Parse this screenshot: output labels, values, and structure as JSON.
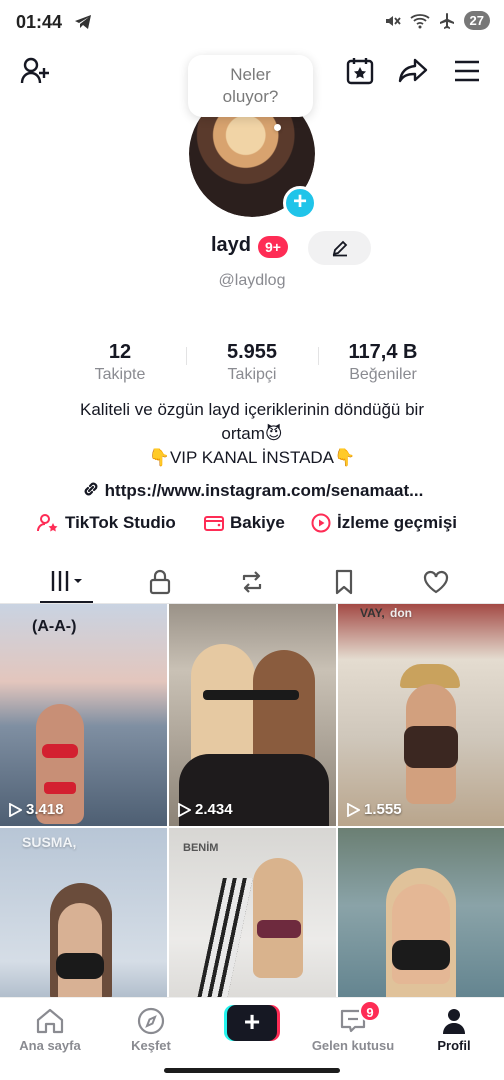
{
  "status": {
    "time": "01:44",
    "battery": "27"
  },
  "header": {
    "bubble_line1": "Neler",
    "bubble_line2": "oluyor?"
  },
  "profile": {
    "username": "layd",
    "badge": "9+",
    "handle": "@laydlog",
    "stats": [
      {
        "value": "12",
        "label": "Takipte"
      },
      {
        "value": "5.955",
        "label": "Takipçi"
      },
      {
        "value": "117,4 B",
        "label": "Beğeniler"
      }
    ],
    "bio_line1": "Kaliteli ve özgün layd içeriklerinin döndüğü bir",
    "bio_line2": "ortam😈",
    "bio_line3": "👇VIP KANAL İNSTADA👇",
    "link": "https://www.instagram.com/senamaat..."
  },
  "quick_links": {
    "studio": "TikTok Studio",
    "balance": "Bakiye",
    "history": "İzleme geçmişi"
  },
  "videos": [
    {
      "views": "3.418",
      "caption": "(A-A-)"
    },
    {
      "views": "2.434",
      "caption": ""
    },
    {
      "views": "1.555",
      "caption": "VAY,",
      "caption2": "don"
    },
    {
      "views": "",
      "caption": "SUSMA,"
    },
    {
      "views": "",
      "caption": "BENİM"
    },
    {
      "views": "",
      "caption": ""
    }
  ],
  "bottom_nav": {
    "home": "Ana sayfa",
    "discover": "Keşfet",
    "create": "+",
    "inbox": "Gelen kutusu",
    "inbox_badge": "9",
    "profile": "Profil"
  },
  "colors": {
    "accent": "#fe2c55",
    "cyan": "#25f4ee",
    "text": "#161823",
    "muted": "#8a8b91"
  }
}
